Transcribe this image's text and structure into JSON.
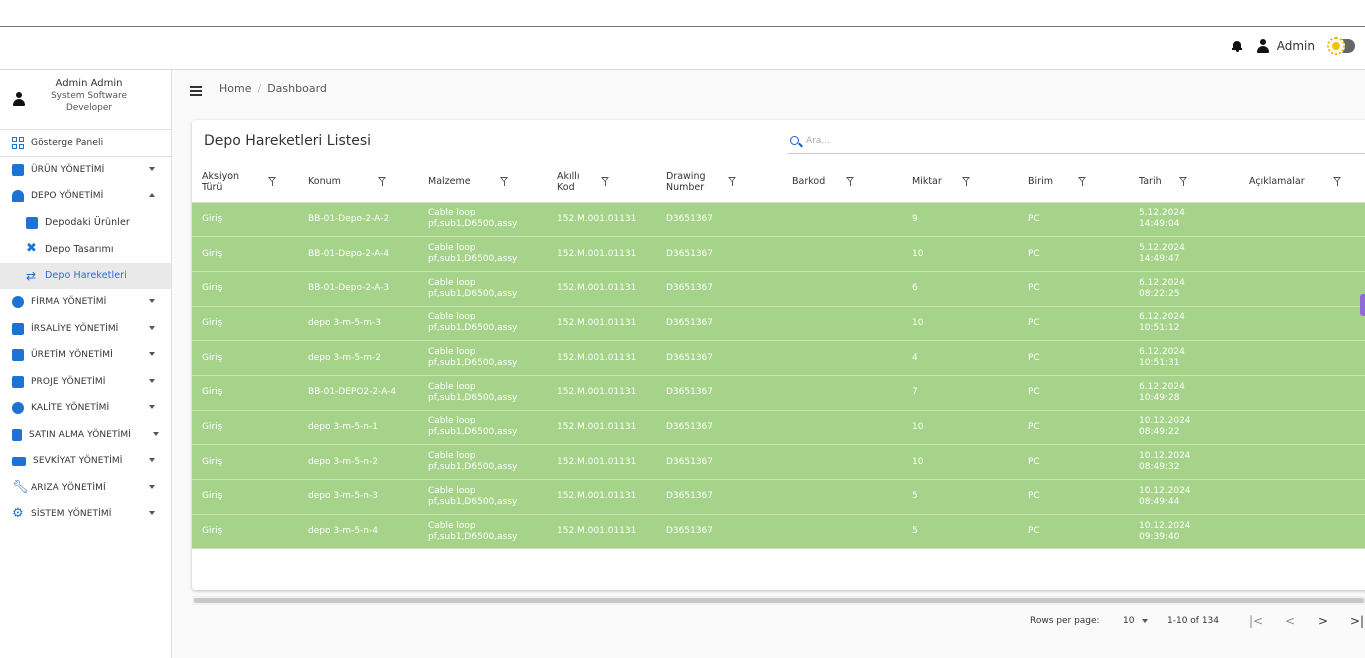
{
  "topbar": {
    "user_label": "Admin"
  },
  "profile": {
    "name": "Admin Admin",
    "role": "System Software Developer"
  },
  "sidebar": {
    "items": [
      {
        "label": "Gösterge Paneli"
      },
      {
        "label": "ÜRÜN YÖNETİMİ"
      },
      {
        "label": "DEPO YÖNETİMİ"
      },
      {
        "label": "Depodaki Ürünler"
      },
      {
        "label": "Depo Tasarımı"
      },
      {
        "label": "Depo Hareketleri"
      },
      {
        "label": "FİRMA YÖNETİMİ"
      },
      {
        "label": "İRSALİYE YÖNETİMİ"
      },
      {
        "label": "ÜRETİM YÖNETİMİ"
      },
      {
        "label": "PROJE YÖNETİMİ"
      },
      {
        "label": "KALİTE YÖNETİMİ"
      },
      {
        "label": "SATIN ALMA YÖNETİMİ"
      },
      {
        "label": "SEVKİYAT YÖNETİMİ"
      },
      {
        "label": "ARIZA YÖNETİMİ"
      },
      {
        "label": "SİSTEM YÖNETİMİ"
      }
    ]
  },
  "breadcrumb": {
    "home": "Home",
    "sep": "/",
    "current": "Dashboard"
  },
  "card": {
    "title": "Depo Hareketleri Listesi",
    "search_placeholder": "Ara..."
  },
  "table": {
    "headers": [
      "Aksiyon Türü",
      "Konum",
      "Malzeme",
      "Akıllı Kod",
      "Drawing Number",
      "Barkod",
      "Miktar",
      "Birim",
      "Tarih",
      "Açıklamalar"
    ],
    "rows": [
      [
        "Giriş",
        "BB-01-Depo-2-A-2",
        "Cable loop pf,sub1,D6500,assy",
        "152.M.001.01131",
        "D3651367",
        "",
        "9",
        "PC",
        "5.12.2024 14:49:04",
        ""
      ],
      [
        "Giriş",
        "BB-01-Depo-2-A-4",
        "Cable loop pf,sub1,D6500,assy",
        "152.M.001.01131",
        "D3651367",
        "",
        "10",
        "PC",
        "5.12.2024 14:49:47",
        ""
      ],
      [
        "Giriş",
        "BB-01-Depo-2-A-3",
        "Cable loop pf,sub1,D6500,assy",
        "152.M.001.01131",
        "D3651367",
        "",
        "6",
        "PC",
        "6.12.2024 08:22:25",
        ""
      ],
      [
        "Giriş",
        "depo 3-m-5-m-3",
        "Cable loop pf,sub1,D6500,assy",
        "152.M.001.01131",
        "D3651367",
        "",
        "10",
        "PC",
        "6.12.2024 10:51:12",
        ""
      ],
      [
        "Giriş",
        "depo 3-m-5-m-2",
        "Cable loop pf,sub1,D6500,assy",
        "152.M.001.01131",
        "D3651367",
        "",
        "4",
        "PC",
        "6.12.2024 10:51:31",
        ""
      ],
      [
        "Giriş",
        "BB-01-DEPO2-2-A-4",
        "Cable loop pf,sub1,D6500,assy",
        "152.M.001.01131",
        "D3651367",
        "",
        "7",
        "PC",
        "6.12.2024 10:49:28",
        ""
      ],
      [
        "Giriş",
        "depo 3-m-5-n-1",
        "Cable loop pf,sub1,D6500,assy",
        "152.M.001.01131",
        "D3651367",
        "",
        "10",
        "PC",
        "10.12.2024 08:49:22",
        ""
      ],
      [
        "Giriş",
        "depo 3-m-5-n-2",
        "Cable loop pf,sub1,D6500,assy",
        "152.M.001.01131",
        "D3651367",
        "",
        "10",
        "PC",
        "10.12.2024 08:49:32",
        ""
      ],
      [
        "Giriş",
        "depo 3-m-5-n-3",
        "Cable loop pf,sub1,D6500,assy",
        "152.M.001.01131",
        "D3651367",
        "",
        "5",
        "PC",
        "10.12.2024 08:49:44",
        ""
      ],
      [
        "Giriş",
        "depo 3-m-5-n-4",
        "Cable loop pf,sub1,D6500,assy",
        "152.M.001.01131",
        "D3651367",
        "",
        "5",
        "PC",
        "10.12.2024 09:39:40",
        ""
      ]
    ]
  },
  "pagination": {
    "rows_per_page_label": "Rows per page:",
    "rows_per_page": "10",
    "range": "1-10 of 134",
    "first": "|<",
    "prev": "<",
    "next": ">",
    "last": ">|"
  },
  "colors": {
    "row_bg": "#a6d38a",
    "accent": "#1d73d3"
  },
  "icons": [
    "bell-icon",
    "user-icon",
    "theme-toggle-icon",
    "menu-icon",
    "search-icon",
    "filter-icon"
  ]
}
